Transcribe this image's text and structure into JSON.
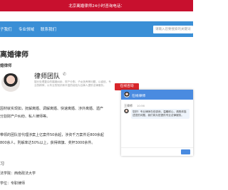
{
  "topbar": {
    "announcement": "北京离婚律师24小时咨询电话："
  },
  "nav": {
    "items": [
      "子我们",
      "专业领域",
      "联系我们"
    ],
    "search_placeholder": "请输入您要搜索的关键词"
  },
  "page": {
    "title": "离婚律师",
    "subtitle": "婚律师"
  },
  "team_card": {
    "title": "律师团队",
    "phone_symbol": "✆",
    "description": "擅长处理复杂的婚姻纠纷、财产分割、子女抚养等问题，以诚信、专业的精神，以专业的知识和丰富的经验为当事人提供法律服务。",
    "consult_button": "在线咨询"
  },
  "paragraphs": [
    "因材就实现如，抚解离婚、调解离婚、快速离婚、涉外离婚、遗产",
    "分割财产户纠纷、私人律师等。",
    "带领的团队曾代理涉案上亿案件50余起，涉资千万案件近800余起",
    "800余人，刑解率达50%以上，获得锦旗、奖杯3000余件。"
  ],
  "section_heading": "习",
  "school_lines": [
    "法学院：西南政法大学",
    "学位：专职律师"
  ],
  "chat": {
    "header_title": "在线律师",
    "sender_name": "王律师",
    "time": "10:56",
    "message": "您好！专业律师在线咨询，温暖耐心，请具体描述您的问题，我们将为您提供专业法律服务。"
  },
  "colors": {
    "topbar": "#c8102e",
    "nav": "#3a8fd6",
    "button": "#d8262b",
    "chat_header": "#4a8be0"
  }
}
